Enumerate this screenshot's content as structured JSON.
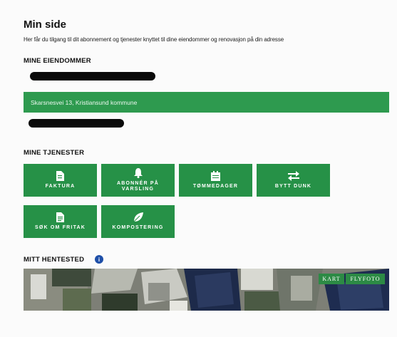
{
  "page": {
    "title": "Min side",
    "intro": "Her får du tilgang til dit abonnement og tjenester knyttet til dine eiendommer og renovasjon på din adresse"
  },
  "properties": {
    "heading": "MINE EIENDOMMER",
    "selected_address": "Skarsnesvei 13, Kristiansund kommune"
  },
  "services": {
    "heading": "MINE TJENESTER",
    "tiles": [
      {
        "label": "FAKTURA",
        "icon": "invoice-icon"
      },
      {
        "label": "ABONNÉR PÅ VARSLING",
        "icon": "bell-icon"
      },
      {
        "label": "TØMMEDAGER",
        "icon": "calendar-icon"
      },
      {
        "label": "BYTT DUNK",
        "icon": "swap-arrows-icon"
      },
      {
        "label": "SØK OM FRITAK",
        "icon": "document-icon"
      },
      {
        "label": "KOMPOSTERING",
        "icon": "leaf-icon"
      }
    ]
  },
  "pickup": {
    "heading": "MITT HENTESTED",
    "info_badge": "i",
    "map_buttons": [
      "KART",
      "FLYFOTO"
    ]
  },
  "colors": {
    "accent_green": "#269147",
    "property_bar": "#2e9a4f",
    "info_badge": "#1f4fa8"
  }
}
